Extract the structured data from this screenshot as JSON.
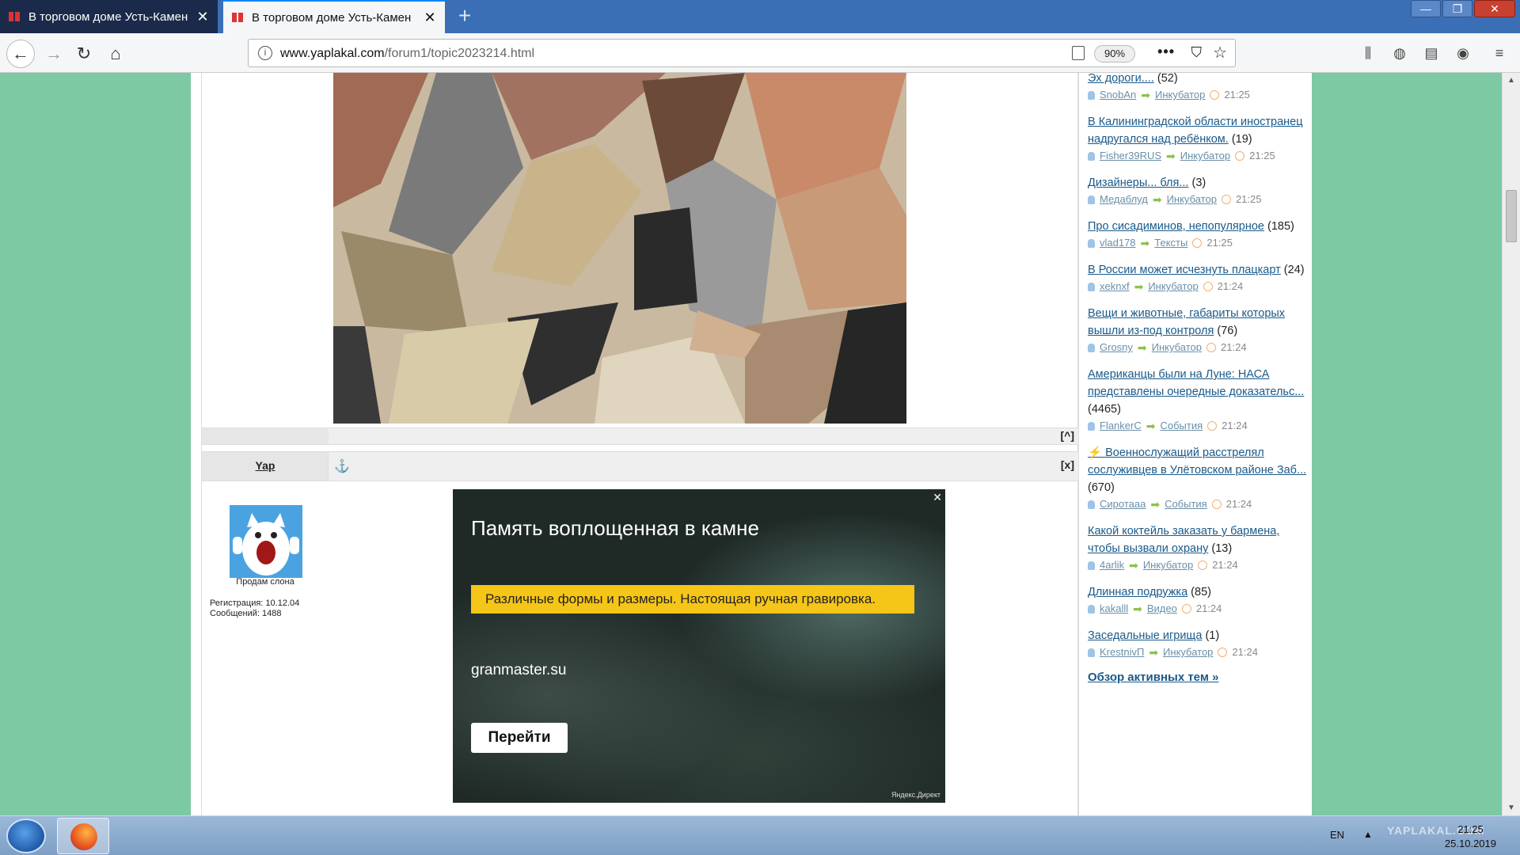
{
  "browser": {
    "tabs": [
      {
        "title": "В торговом доме Усть-Камен",
        "active": false
      },
      {
        "title": "В торговом доме Усть-Камен",
        "active": true
      }
    ],
    "new_tab_glyph": "+",
    "window_buttons": [
      "—",
      "❐",
      "✕"
    ],
    "url_domain": "www.yaplakal.com",
    "url_path": "/forum1/topic2023214.html",
    "zoom": "90%",
    "more_glyph": "•••",
    "icons": {
      "back": "back-arrow-icon",
      "forward": "forward-arrow-icon",
      "reload": "reload-icon",
      "home": "home-icon",
      "info": "info-icon",
      "reader": "reader-view-icon",
      "pocket": "pocket-icon",
      "bookmark": "star-icon",
      "library": "library-icon",
      "sync": "globe-icon",
      "sidebar": "sidebar-icon",
      "account": "account-icon",
      "menu": "hamburger-menu-icon"
    }
  },
  "post": {
    "up_label": "[^]",
    "author": "Yap",
    "anchor": "⚓",
    "close_label": "[x]",
    "user_status": "Продам слона",
    "registration": "Регистрация: 10.12.04",
    "messages": "Сообщений: 1488"
  },
  "ad": {
    "close": "✕",
    "headline": "Память воплощенная в камне",
    "tagline": "Различные формы и размеры. Настоящая ручная гравировка.",
    "domain": "granmaster.su",
    "button": "Перейти",
    "source": "Яндекс.Директ"
  },
  "sidebar": {
    "topics": [
      {
        "title": "Эх дороги....",
        "count": "(52)",
        "user": "SnobAn",
        "category": "Инкубатор",
        "time": "21:25"
      },
      {
        "title": "В Калининградской области иностранец надругался над ребёнком.",
        "count": "(19)",
        "user": "Fisher39RUS",
        "category": "Инкубатор",
        "time": "21:25"
      },
      {
        "title": "Дизайнеры... бля...",
        "count": "(3)",
        "user": "Медаблуд",
        "category": "Инкубатор",
        "time": "21:25"
      },
      {
        "title": "Про сисадиминов, непопулярное",
        "count": "(185)",
        "user": "vlad178",
        "category": "Тексты",
        "time": "21:25"
      },
      {
        "title": "В России может исчезнуть плацкарт",
        "count": "(24)",
        "user": "xeknxf",
        "category": "Инкубатор",
        "time": "21:24"
      },
      {
        "title": "Вещи и животные, габариты которых вышли из-под контроля",
        "count": "(76)",
        "user": "Grosny",
        "category": "Инкубатор",
        "time": "21:24"
      },
      {
        "title": "Американцы были на Луне: НАСА представлены очередные доказательс...",
        "count": "(4465)",
        "user": "FlankerC",
        "category": "События",
        "time": "21:24"
      },
      {
        "title": "⚡ Военнослужащий расстрелял сослуживцев в Улётовском районе Заб...",
        "count": "(670)",
        "user": "Сиротааа",
        "category": "События",
        "time": "21:24"
      },
      {
        "title": "Какой коктейль заказать у бармена, чтобы вызвали охрану",
        "count": "(13)",
        "user": "4arlik",
        "category": "Инкубатор",
        "time": "21:24"
      },
      {
        "title": "Длинная подружка",
        "count": "(85)",
        "user": "kakalll",
        "category": "Видео",
        "time": "21:24"
      },
      {
        "title": "Заседальные игрища",
        "count": "(1)",
        "user": "KrestnivП",
        "category": "Инкубатор",
        "time": "21:24"
      }
    ],
    "overview": "Обзор активных тем »"
  },
  "taskbar": {
    "lang": "EN",
    "tray": "▲",
    "time": "21:25",
    "date": "25.10.2019",
    "watermark": "YAPLAKAL.COM"
  }
}
